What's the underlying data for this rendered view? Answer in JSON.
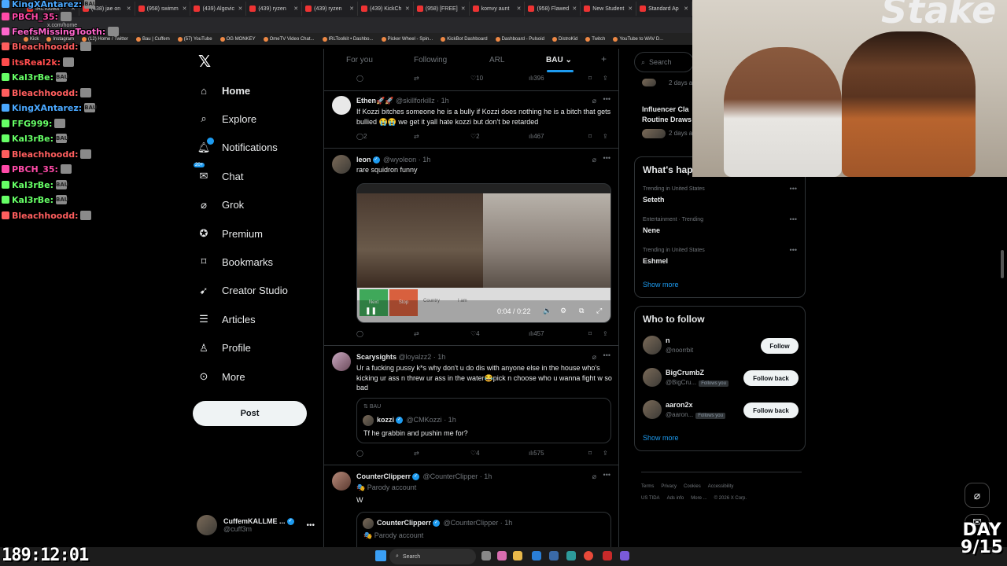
{
  "browser": {
    "tabs": [
      "IRLToolkit -",
      "(438) jae on",
      "(958) swimm",
      "(439) Algovic",
      "(439) ryzen",
      "(439) ryzen",
      "(439) KickCh",
      "(958) [FREE]",
      "komvy aunt",
      "(958) Flawed",
      "New Student",
      "Standard Ap"
    ],
    "address": "x.com/home",
    "bookmarks": [
      "Kick",
      "Instagram",
      "(12) Home / Twitter",
      "Bau | Cuffem",
      "(57) YouTube",
      "OG MONKEY",
      "OmeTV Video Chat...",
      "IRLToolkit • Dashbo...",
      "Picker Wheel - Spin...",
      "KickBot Dashboard",
      "Dashboard - Pulsoid",
      "DistroKid",
      "Twitch",
      "YouTube to WAV D..."
    ]
  },
  "chat": [
    {
      "user": "KingXAntarez:",
      "msg": "BAU",
      "color": "#4aa8ff"
    },
    {
      "user": "PBCH_35:",
      "msg": "",
      "color": "#ff4aa8"
    },
    {
      "user": "FeefsMissingTooth:",
      "msg": "",
      "color": "#ff66cc"
    },
    {
      "user": "Bleachhoodd:",
      "msg": "",
      "color": "#ff5e5e"
    },
    {
      "user": "itsReal2k:",
      "msg": "",
      "color": "#ff4d4d"
    },
    {
      "user": "Kal3rBe:",
      "msg": "BAU",
      "color": "#66ff66"
    },
    {
      "user": "Bleachhoodd:",
      "msg": "",
      "color": "#ff5e5e"
    },
    {
      "user": "KingXAntarez:",
      "msg": "BAU",
      "color": "#4aa8ff"
    },
    {
      "user": "FFG999:",
      "msg": "",
      "color": "#66ff66"
    },
    {
      "user": "Kal3rBe:",
      "msg": "BAU",
      "color": "#66ff66"
    },
    {
      "user": "Bleachhoodd:",
      "msg": "",
      "color": "#ff5e5e"
    },
    {
      "user": "PBCH_35:",
      "msg": "",
      "color": "#ff4aa8"
    },
    {
      "user": "Kal3rBe:",
      "msg": "BAU",
      "color": "#66ff66"
    },
    {
      "user": "Kal3rBe:",
      "msg": "BAU",
      "color": "#66ff66"
    },
    {
      "user": "Bleachhoodd:",
      "msg": "",
      "color": "#ff5e5e"
    }
  ],
  "nav": {
    "items": [
      {
        "label": "Home",
        "icon": "home-icon"
      },
      {
        "label": "Explore",
        "icon": "search-icon"
      },
      {
        "label": "Notifications",
        "icon": "bell-icon"
      },
      {
        "label": "Chat",
        "icon": "chat-icon",
        "badge": "20+"
      },
      {
        "label": "Grok",
        "icon": "grok-icon"
      },
      {
        "label": "Premium",
        "icon": "premium-icon"
      },
      {
        "label": "Bookmarks",
        "icon": "bookmark-icon"
      },
      {
        "label": "Creator Studio",
        "icon": "rocket-icon"
      },
      {
        "label": "Articles",
        "icon": "article-icon"
      },
      {
        "label": "Profile",
        "icon": "person-icon"
      },
      {
        "label": "More",
        "icon": "more-circle-icon"
      }
    ],
    "post_label": "Post",
    "account": {
      "name": "CuffemKALLME ...",
      "handle": "@cuff3m"
    }
  },
  "timeline": {
    "tabs": [
      "For you",
      "Following",
      "ARL",
      "BAU"
    ],
    "active_tab": "BAU",
    "top_actions": {
      "likes": "10",
      "views": "396"
    },
    "tweets": [
      {
        "name": "Ethen🚀🚀",
        "handle": "@skillforkillz",
        "time": "· 1h",
        "text": "If Kozzi bitches someone he is a bully if Kozzi does nothing he is a bitch that gets bullied 😭😭 we get it yall hate kozzi but don't be retarded",
        "replies": "2",
        "likes": "2",
        "views": "467"
      },
      {
        "name": "leon",
        "handle": "@wyoleon",
        "time": "· 1h",
        "text": "rare squidron funny",
        "video_time": "0:04 / 0:22",
        "video_buttons": [
          "Next",
          "Stop",
          "Country",
          "I am"
        ],
        "likes": "4",
        "views": "457"
      },
      {
        "name": "Scarysights",
        "handle": "@loyalzz2",
        "time": "· 1h",
        "text": "Ur a fucking pussy k*s why don't u do dis with anyone else in the house who's kicking ur ass n threw ur ass in the water😂pick n choose who u wanna fight w so bad",
        "quote": {
          "context": "BAU",
          "name": "kozzi",
          "handle": "@CMKozzi",
          "time": "· 1h",
          "text": "Tf he grabbin and pushin me for?"
        },
        "likes": "4",
        "views": "575"
      },
      {
        "name": "CounterClipperr",
        "handle": "@CounterClipper",
        "time": "· 1h",
        "label": "Parody account",
        "text": "W",
        "quote": {
          "name": "CounterClipperr",
          "handle": "@CounterClipper",
          "time": "· 1h",
          "label": "Parody account"
        }
      }
    ]
  },
  "sidebar": {
    "search_placeholder": "Search",
    "cards": [
      {
        "text": "2 days a"
      },
      {
        "text": "Influencer Cla"
      },
      {
        "text": "Routine Draws"
      },
      {
        "text": "2 days a"
      }
    ],
    "whats_happening": "What's hap",
    "trends": [
      {
        "meta": "Trending in United States",
        "name": "Seteth"
      },
      {
        "meta": "Entertainment · Trending",
        "name": "Nene"
      },
      {
        "meta": "Trending in United States",
        "name": "Eshmel"
      }
    ],
    "show_more": "Show more",
    "who_to_follow": "Who to follow",
    "follow": [
      {
        "name": "n",
        "handle": "@noorrbit",
        "button": "Follow",
        "follows_you": ""
      },
      {
        "name": "BigCrumbZ",
        "handle": "@BigCru...",
        "button": "Follow back",
        "follows_you": "Follows you"
      },
      {
        "name": "aaron2x",
        "handle": "@aaron...",
        "button": "Follow back",
        "follows_you": "Follows you"
      }
    ],
    "footer": [
      "Terms",
      "Privacy",
      "Cookies",
      "Accessibility",
      "US TIDA",
      "Ads info",
      "More ...",
      "© 2026 X Corp."
    ]
  },
  "stream": {
    "clock": "189:12:01",
    "day_line1": "DAY",
    "day_line2": "9/15",
    "cam_sign": "Stake"
  },
  "taskbar": {
    "search_placeholder": "Search"
  },
  "colors": {
    "accent": "#1d9bf0",
    "background": "#000000",
    "border": "#2f3336",
    "muted": "#71767b"
  }
}
